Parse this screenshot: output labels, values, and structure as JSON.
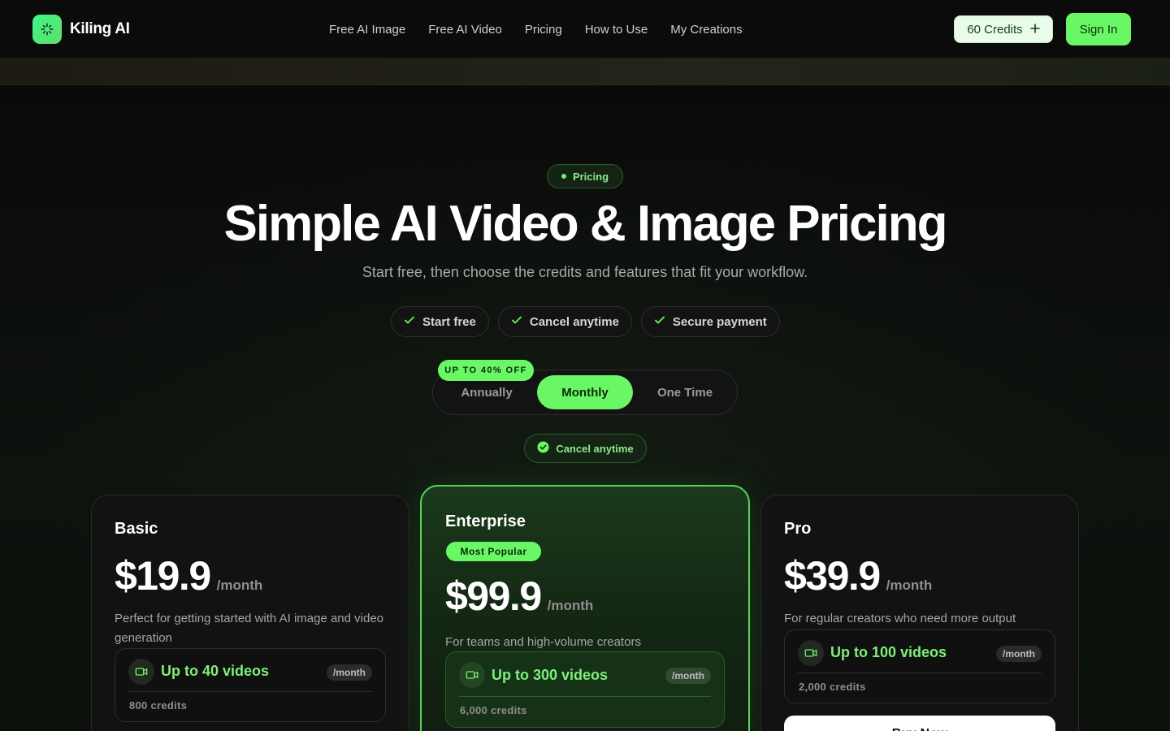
{
  "header": {
    "brand": "Kiling AI",
    "nav": [
      "Free AI Image",
      "Free AI Video",
      "Pricing",
      "How to Use",
      "My Creations"
    ],
    "credits_label": "60 Credits",
    "signin_label": "Sign In"
  },
  "hero": {
    "eyebrow": "Pricing",
    "title": "Simple AI Video & Image Pricing",
    "subtitle": "Start free, then choose the credits and features that fit your workflow.",
    "features": [
      "Start free",
      "Cancel anytime",
      "Secure payment"
    ]
  },
  "billing": {
    "options": [
      "Annually",
      "Monthly",
      "One Time"
    ],
    "selected": "Monthly",
    "discount_badge": "UP TO 40% OFF",
    "note": "Cancel anytime"
  },
  "plans": {
    "basic": {
      "name": "Basic",
      "price": "$19.9",
      "period": "/month",
      "description": "Perfect for getting started with AI image and video generation",
      "quota": "Up to 40 videos",
      "quota_period": "/month",
      "credits": "800 credits"
    },
    "enterprise": {
      "name": "Enterprise",
      "badge": "Most Popular",
      "price": "$99.9",
      "period": "/month",
      "description": "For teams and high-volume creators",
      "quota": "Up to 300 videos",
      "quota_period": "/month",
      "credits": "6,000 credits"
    },
    "pro": {
      "name": "Pro",
      "price": "$39.9",
      "period": "/month",
      "description": "For regular creators who need more output",
      "quota": "Up to 100 videos",
      "quota_period": "/month",
      "credits": "2,000 credits",
      "cta": "Buy Now"
    }
  },
  "colors": {
    "accent": "#6af765",
    "background": "#0b0c0b"
  }
}
